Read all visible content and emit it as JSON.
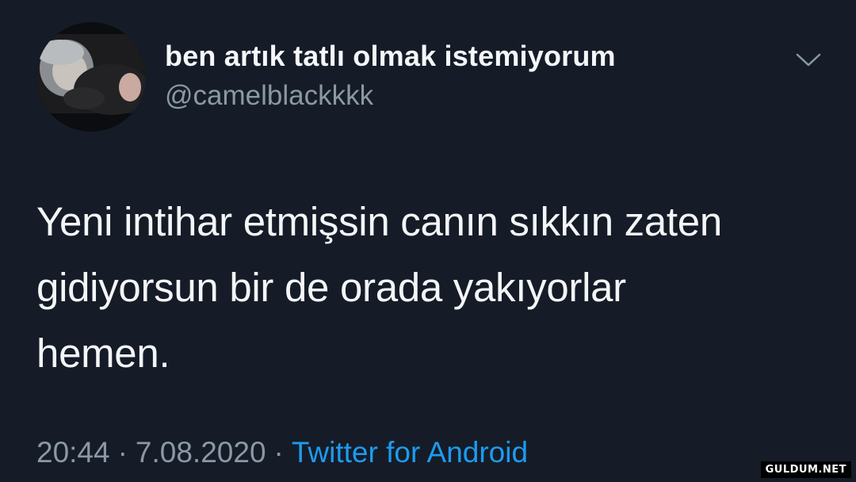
{
  "author": {
    "display_name": "ben artık tatlı olmak istemiyorum",
    "handle": "@camelblackkkk"
  },
  "tweet": {
    "lines": [
      "Yeni intihar etmişsin canın sıkkın zaten",
      "gidiyorsun bir de orada yakıyorlar",
      "hemen."
    ]
  },
  "meta": {
    "time": "20:44",
    "separator": "·",
    "date": "7.08.2020",
    "source": "Twitter for Android"
  },
  "watermark": "GULDUM.NET",
  "icons": {
    "menu": "chevron-down-icon"
  },
  "colors": {
    "background": "#151c27",
    "secondary_text": "#8b98a5",
    "link": "#1d9bf0"
  }
}
